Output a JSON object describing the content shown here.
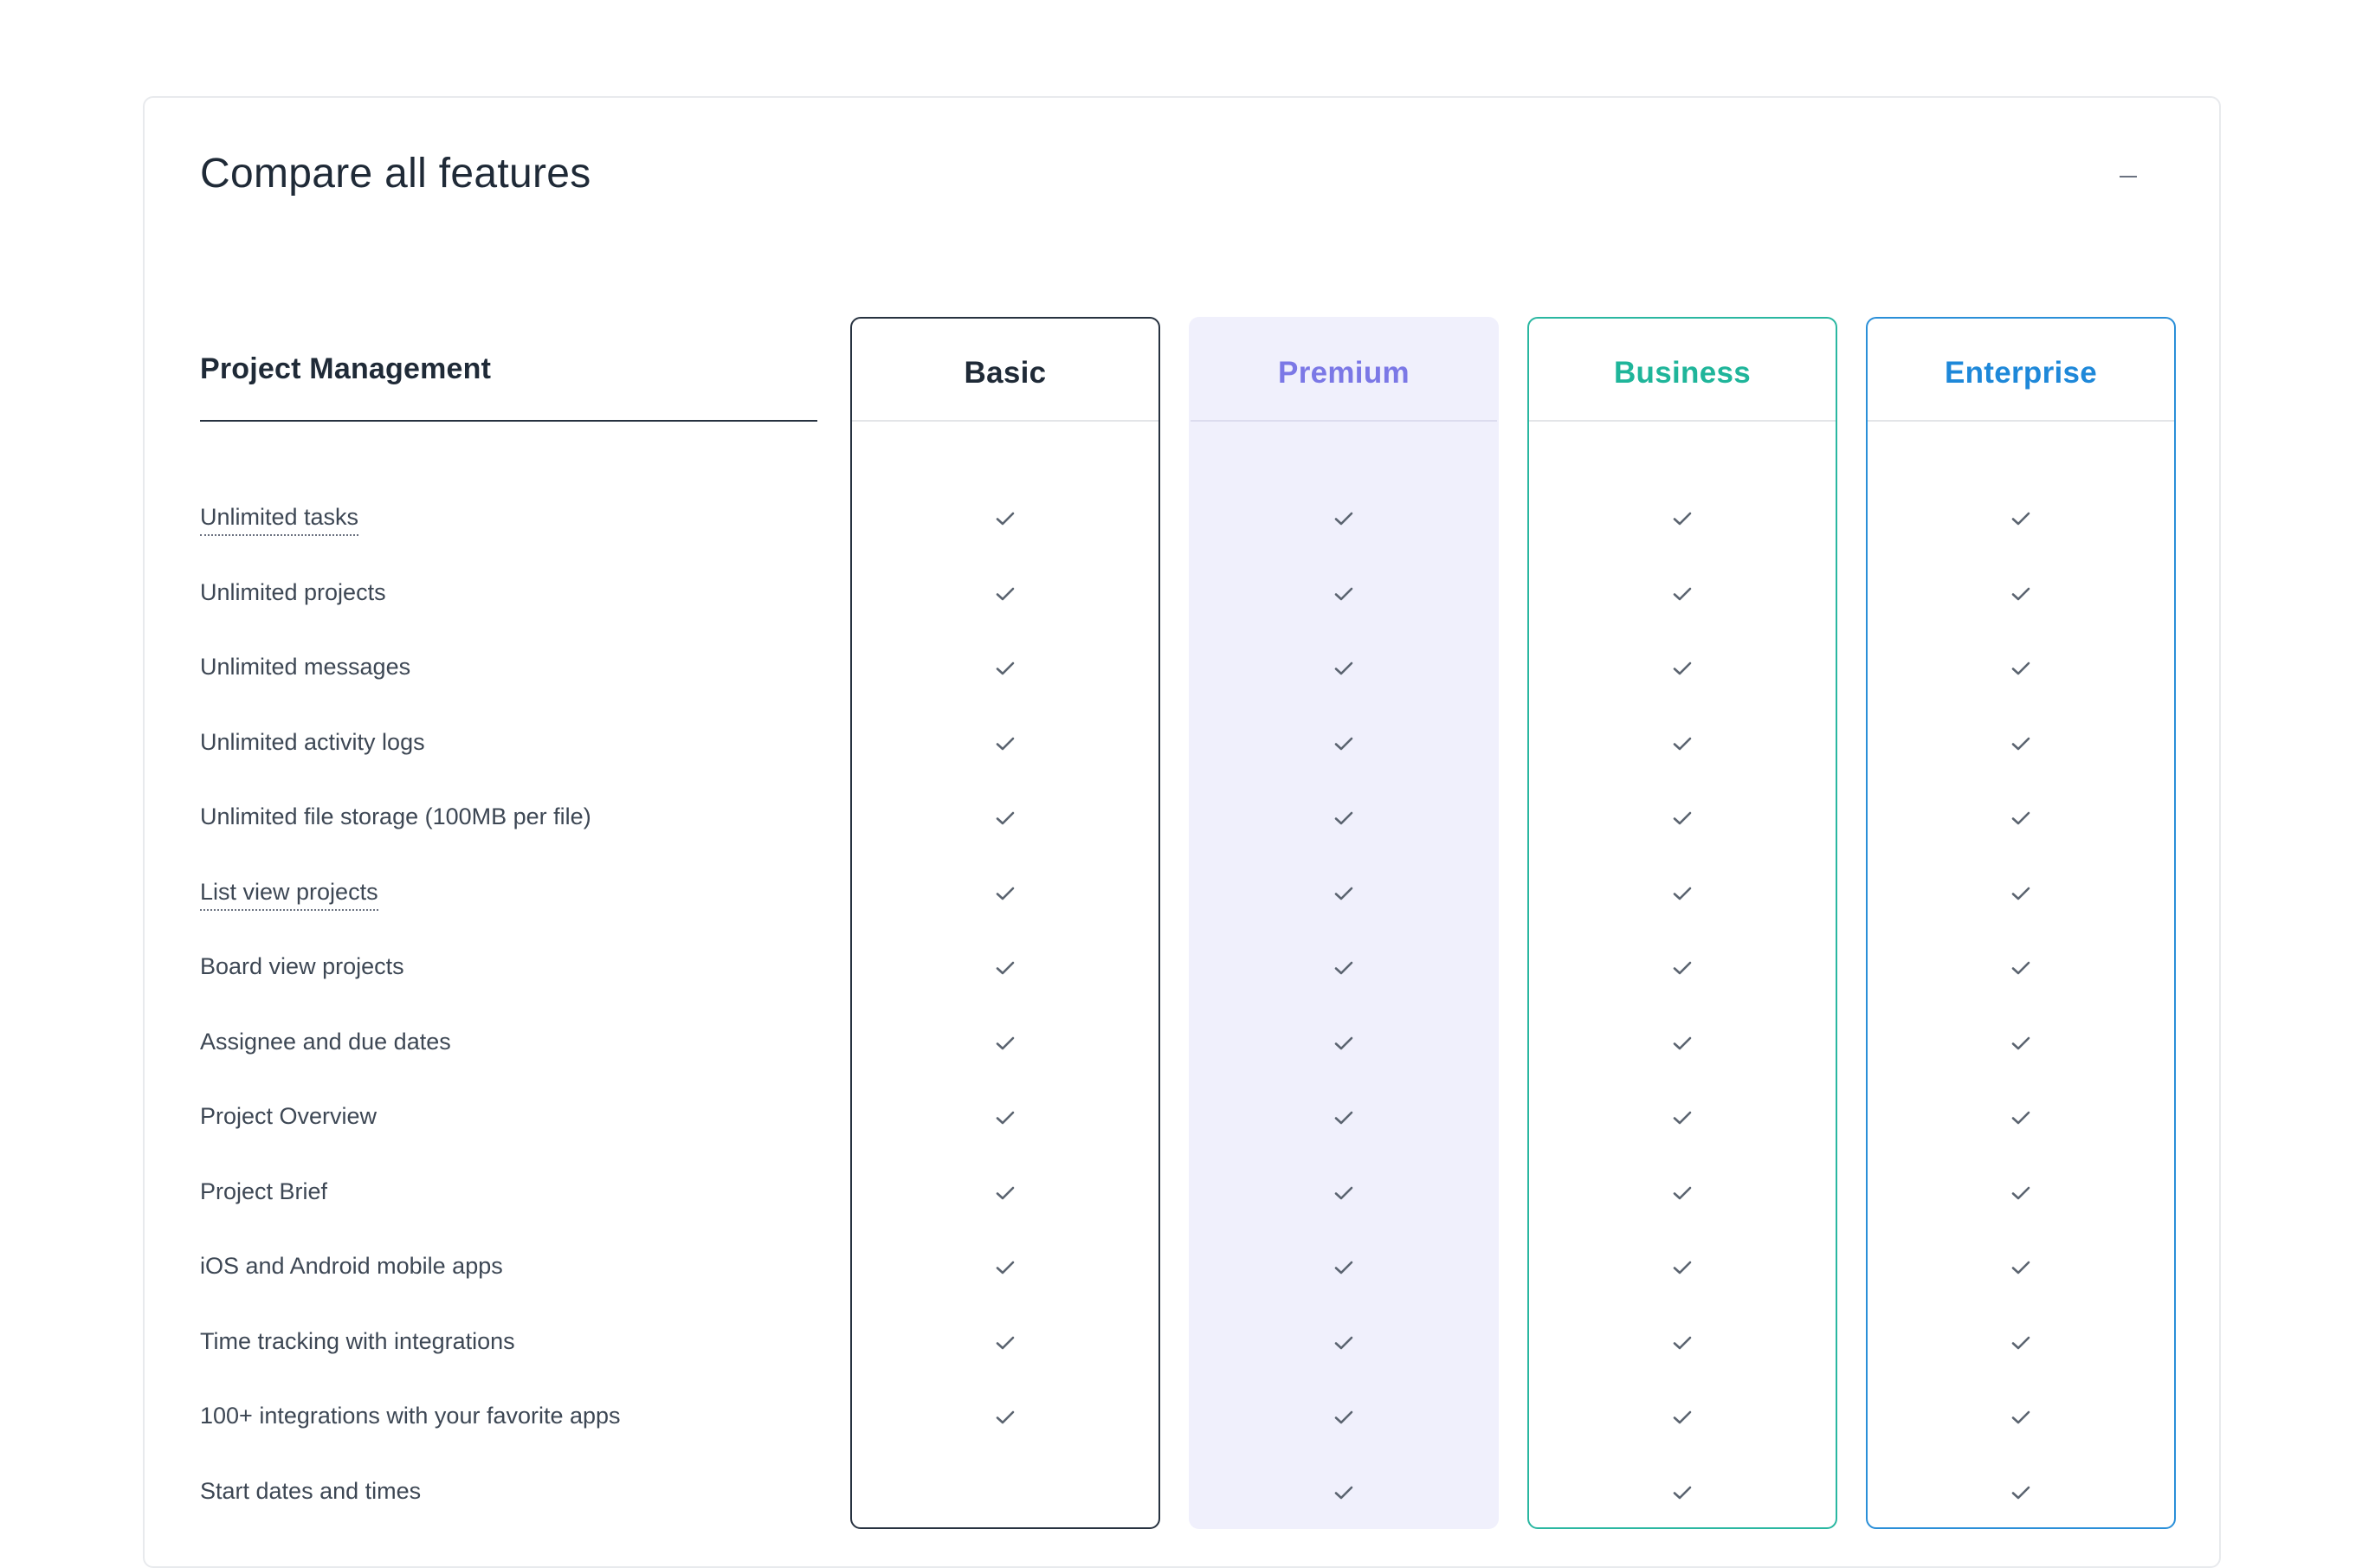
{
  "header": {
    "title": "Compare all features",
    "collapse_icon": "minus-icon"
  },
  "section": {
    "title": "Project Management"
  },
  "plans": [
    {
      "id": "basic",
      "name": "Basic",
      "color": "#1f2a37",
      "border": "#273240",
      "background": "#ffffff"
    },
    {
      "id": "premium",
      "name": "Premium",
      "color": "#7b78e6",
      "border": "#f0f0fc",
      "background": "#f0f0fc"
    },
    {
      "id": "business",
      "name": "Business",
      "color": "#1fb59a",
      "border": "#2ab7a1",
      "background": "#ffffff"
    },
    {
      "id": "enterprise",
      "name": "Enterprise",
      "color": "#1e88d9",
      "border": "#2a8fd8",
      "background": "#ffffff"
    }
  ],
  "features": [
    {
      "label": "Unlimited tasks",
      "tooltip": true,
      "included": [
        true,
        true,
        true,
        true
      ]
    },
    {
      "label": "Unlimited projects",
      "tooltip": false,
      "included": [
        true,
        true,
        true,
        true
      ]
    },
    {
      "label": "Unlimited messages",
      "tooltip": false,
      "included": [
        true,
        true,
        true,
        true
      ]
    },
    {
      "label": "Unlimited activity logs",
      "tooltip": false,
      "included": [
        true,
        true,
        true,
        true
      ]
    },
    {
      "label": "Unlimited file storage (100MB per file)",
      "tooltip": false,
      "included": [
        true,
        true,
        true,
        true
      ]
    },
    {
      "label": "List view projects",
      "tooltip": true,
      "included": [
        true,
        true,
        true,
        true
      ]
    },
    {
      "label": "Board view projects",
      "tooltip": false,
      "included": [
        true,
        true,
        true,
        true
      ]
    },
    {
      "label": "Assignee and due dates",
      "tooltip": false,
      "included": [
        true,
        true,
        true,
        true
      ]
    },
    {
      "label": "Project Overview",
      "tooltip": false,
      "included": [
        true,
        true,
        true,
        true
      ]
    },
    {
      "label": "Project Brief",
      "tooltip": false,
      "included": [
        true,
        true,
        true,
        true
      ]
    },
    {
      "label": "iOS and Android mobile apps",
      "tooltip": false,
      "included": [
        true,
        true,
        true,
        true
      ]
    },
    {
      "label": "Time tracking with integrations",
      "tooltip": false,
      "included": [
        true,
        true,
        true,
        true
      ]
    },
    {
      "label": "100+ integrations with your favorite apps",
      "tooltip": false,
      "included": [
        true,
        true,
        true,
        true
      ]
    },
    {
      "label": "Start dates and times",
      "tooltip": false,
      "included": [
        false,
        true,
        true,
        true
      ]
    }
  ],
  "check_icon": "check-icon",
  "check_color": "#5b6470"
}
